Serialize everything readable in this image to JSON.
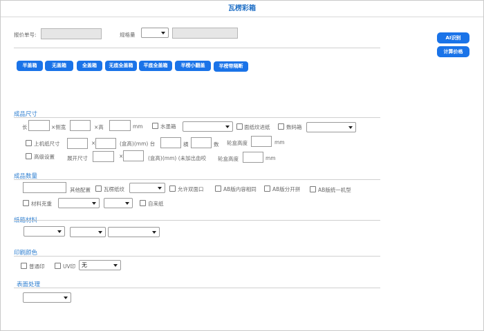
{
  "title": "瓦楞彩箱",
  "header": {
    "quote_no_label": "报价单号:",
    "spec_label": "规格量",
    "ai_button": "AI识别",
    "calc_button": "计算价格"
  },
  "box_types": [
    "半盖箱",
    "无盖箱",
    "全盖箱",
    "无底全盖箱",
    "平底全盖箱",
    "半榜小翻盖",
    "半榜带隔断"
  ],
  "sections": {
    "size": "成品尺寸",
    "qty": "成品数量",
    "material": "纸箱材料",
    "print": "印刷颜色",
    "surface": "表面处理"
  },
  "size": {
    "length": "长",
    "width": "×侧宽",
    "height": "×高",
    "unit": "mm",
    "water_box": "水墨箱",
    "inner_paper": "面纸纹进纸",
    "count_box": "数码箱",
    "machine_size": "上机纸尺寸",
    "times": "×",
    "box_height_mm": "(盒高)(mm) 台",
    "row": "横",
    "count": "数",
    "bite_height": "轮盒高度",
    "mm": "mm",
    "advanced": "高级设置",
    "expand_size": "展开尺寸",
    "times2": "×",
    "no_bleed": "(盒高)(mm) (未加出血咬",
    "bite_height2": "轮盒高度",
    "mm2": "mm"
  },
  "qty": {
    "other_config": "其他配置",
    "flute_paper": "瓦楞纸纹",
    "allow_flip": "允许双面口",
    "ab_same": "AB版内容相同",
    "ab_split": "AB版分开拼",
    "ab_unified": "AB版统一机型",
    "material_weight": "材料克重",
    "self_paper": "自来纸"
  },
  "print": {
    "normal": "普通印",
    "uv": "UV印",
    "select_value": "无"
  }
}
